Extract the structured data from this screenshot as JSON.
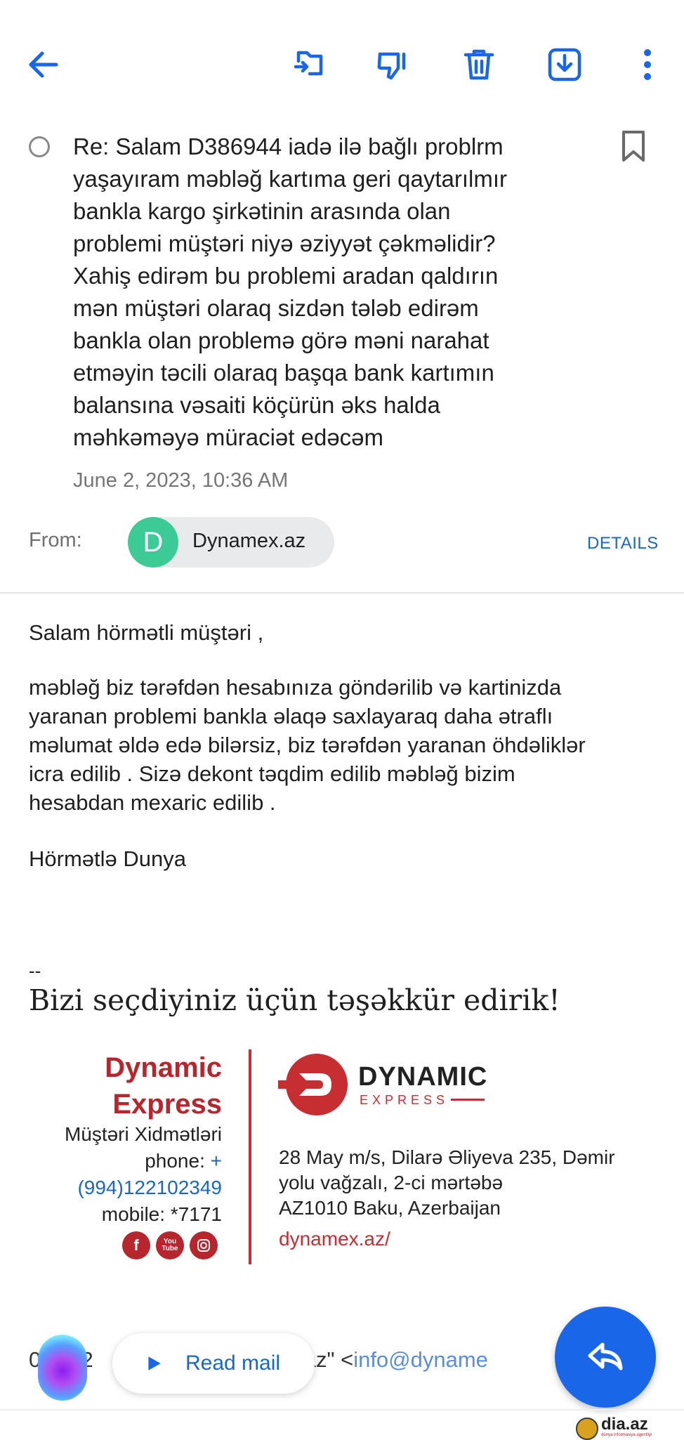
{
  "toolbar": {
    "back_icon": "arrow-left-icon",
    "move_icon": "move-to-folder-icon",
    "dislike_icon": "thumbs-down-icon",
    "delete_icon": "trash-icon",
    "archive_icon": "download-box-icon",
    "more_icon": "more-vertical-icon",
    "accent": "#1a66e8"
  },
  "message": {
    "subject_lines": [
      "Re: Salam D386944 iadə ilə bağlı problrm",
      "yaşayıram məbləğ kartıma geri qaytarılmır",
      "bankla kargo şirkətinin arasında olan",
      "problemi müştəri niyə əziyyət çəkməlidir?",
      "Xahiş edirəm bu problemi aradan qaldırın",
      "mən müştəri olaraq sizdən tələb edirəm",
      "bankla olan problemə görə məni narahat",
      "etməyin təcili olaraq başqa bank kartımın",
      "balansına vəsaiti köçürün əks halda",
      "məhkəməyə müraciət edəcəm"
    ],
    "date": "June 2, 2023, 10:36 AM",
    "from_label": "From:",
    "sender_initial": "D",
    "sender_name": "Dynamex.az",
    "details_label": "DETAILS"
  },
  "body": {
    "greeting": "Salam hörmətli müştəri ,",
    "paragraph_lines": [
      "məbləğ biz tərəfdən hesabınıza göndərilib və  kartinizda",
      "yaranan problemi bankla əlaqə saxlayaraq daha ətraflı",
      "məlumat əldə edə bilərsiz, biz tərəfdən yaranan öhdəliklər",
      "icra edilib . Sizə dekont təqdim edilib  məbləğ bizim",
      "hesabdan mexaric edilib ."
    ],
    "closing": "Hörmətlə Dunya",
    "sig_separator": "--",
    "thank_you": "Bizi seçdiyiniz üçün təşəkkür edirik!"
  },
  "signature": {
    "brand_line1": "Dynamic",
    "brand_line2": "Express",
    "dept": "Müştəri Xidmətləri",
    "phone_label": "phone:",
    "phone_plus": "+",
    "phone_number": "(994)122102349",
    "mobile": "mobile: *7171",
    "logo_word1": "DYNAMIC",
    "logo_word2": "EXPRESS",
    "address_line1": "28 May m/s, Dilarə Əliyeva 235, Dəmir",
    "address_line2": "yolu vağzalı, 2-ci mərtəbə",
    "address_line3": "AZ1010 Baku, Azerbaijan",
    "website": "dynamex.az/",
    "social": [
      "f",
      "You Tube",
      "instagram-icon"
    ],
    "brand_color": "#b8262d"
  },
  "quoted": {
    "prefix": "0",
    "fragment1": ".2",
    "fragment2": "ex.az\" <",
    "email_fragment": "info@dyname"
  },
  "bottom": {
    "read_mail_label": "Read mail",
    "reply_icon": "reply-icon",
    "watermark": "dia.az",
    "watermark_sub": "dünya informasiya agentliyi"
  }
}
